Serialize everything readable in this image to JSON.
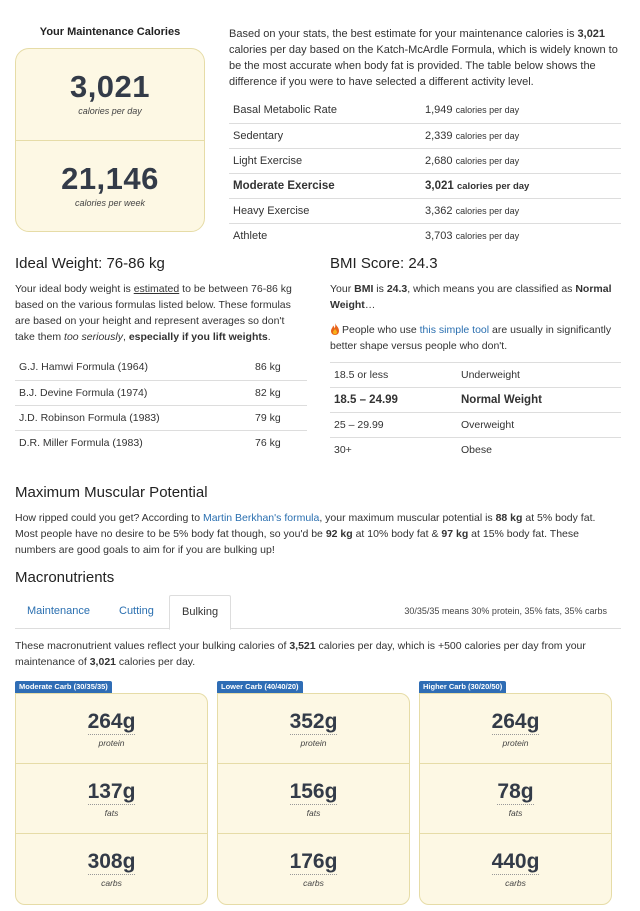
{
  "maintenance": {
    "title": "Your Maintenance Calories",
    "daily_value": "3,021",
    "daily_label": "calories per day",
    "weekly_value": "21,146",
    "weekly_label": "calories per week"
  },
  "intro": {
    "p1": "Based on your stats, the best estimate for your maintenance calories is ",
    "value": "3,021",
    "p2": " calories per day based on the Katch-McArdle Formula, which is widely known to be the most accurate when body fat is provided. The table below shows the difference if you were to have selected a different activity level."
  },
  "activity_unit": "calories per day",
  "activity_levels": [
    {
      "label": "Basal Metabolic Rate",
      "value": "1,949"
    },
    {
      "label": "Sedentary",
      "value": "2,339"
    },
    {
      "label": "Light Exercise",
      "value": "2,680"
    },
    {
      "label": "Moderate Exercise",
      "value": "3,021"
    },
    {
      "label": "Heavy Exercise",
      "value": "3,362"
    },
    {
      "label": "Athlete",
      "value": "3,703"
    }
  ],
  "ideal_weight": {
    "heading": "Ideal Weight: 76-86 kg",
    "t1": "Your ideal body weight is ",
    "estimated": "estimated",
    "t2": " to be between 76-86 kg based on the various formulas listed below. These formulas are based on your height and represent averages so don't take them ",
    "too_seriously": "too seriously",
    "t3": ", ",
    "especially": "especially if you lift weights",
    "t4": ".",
    "formulas": [
      {
        "name": "G.J. Hamwi Formula (1964)",
        "value": "86 kg"
      },
      {
        "name": "B.J. Devine Formula (1974)",
        "value": "82 kg"
      },
      {
        "name": "J.D. Robinson Formula (1983)",
        "value": "79 kg"
      },
      {
        "name": "D.R. Miller Formula (1983)",
        "value": "76 kg"
      }
    ]
  },
  "bmi": {
    "heading": "BMI Score: 24.3",
    "t1": "Your ",
    "bmi_word": "BMI",
    "t2": " is ",
    "score": "24.3",
    "t3": ", which means you are classified as ",
    "class": "Normal Weight",
    "t4": "…",
    "tool_t1": "People who use ",
    "tool_link": "this simple tool",
    "tool_t2": " are usually in significantly better shape versus people who don't.",
    "ranges": [
      {
        "range": "18.5 or less",
        "class": "Underweight"
      },
      {
        "range": "18.5 – 24.99",
        "class": "Normal Weight"
      },
      {
        "range": "25 – 29.99",
        "class": "Overweight"
      },
      {
        "range": "30+",
        "class": "Obese"
      }
    ]
  },
  "muscular": {
    "heading": "Maximum Muscular Potential",
    "t1": "How ripped could you get? According to ",
    "link": "Martin Berkhan's formula",
    "t2": ", your maximum muscular potential is ",
    "v1": "88 kg",
    "t3": " at 5% body fat. Most people have no desire to be 5% body fat though, so you'd be ",
    "v2": "92 kg",
    "t4": " at 10% body fat & ",
    "v3": "97 kg",
    "t5": " at 15% body fat. These numbers are good goals to aim for if you are bulking up!"
  },
  "macros": {
    "heading": "Macronutrients",
    "tabs": [
      "Maintenance",
      "Cutting",
      "Bulking"
    ],
    "active_tab": "Bulking",
    "tab_note": "30/35/35 means 30% protein, 35% fats, 35% carbs",
    "t1": "These macronutrient values reflect your bulking calories of ",
    "v1": "3,521",
    "t2": " calories per day, which is +500 calories per day from your maintenance of ",
    "v2": "3,021",
    "t3": " calories per day.",
    "cards": [
      {
        "badge": "Moderate Carb (30/35/35)",
        "protein": "264g",
        "fats": "137g",
        "carbs": "308g"
      },
      {
        "badge": "Lower Carb (40/40/20)",
        "protein": "352g",
        "fats": "156g",
        "carbs": "176g"
      },
      {
        "badge": "Higher Carb (30/20/50)",
        "protein": "264g",
        "fats": "78g",
        "carbs": "440g"
      }
    ],
    "labels": {
      "protein": "protein",
      "fats": "fats",
      "carbs": "carbs"
    }
  }
}
